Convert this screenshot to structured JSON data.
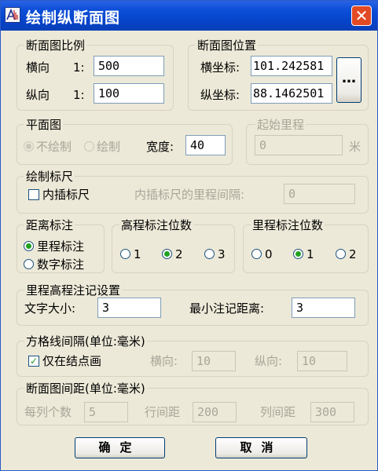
{
  "window": {
    "title": "绘制纵断面图",
    "close_glyph": "✕"
  },
  "scale": {
    "caption": "断面图比例",
    "h_label": "横向",
    "h_prefix": "1:",
    "h_value": "500",
    "v_label": "纵向",
    "v_prefix": "1:",
    "v_value": "100"
  },
  "position": {
    "caption": "断面图位置",
    "x_label": "横坐标:",
    "x_value": "101.242581",
    "y_label": "纵坐标:",
    "y_value": "88.1462501",
    "pick_label": "…"
  },
  "plan": {
    "caption": "平面图",
    "opt_none": "不绘制",
    "opt_draw": "绘制",
    "width_label": "宽度:",
    "width_value": "40"
  },
  "start": {
    "caption": "起始里程",
    "value": "0",
    "unit": "米"
  },
  "ruler": {
    "caption": "绘制标尺",
    "insert_label": "内插标尺",
    "interval_label": "内插标尺的里程间隔:",
    "interval_value": "0"
  },
  "distance": {
    "caption": "距离标注",
    "opt_mileage": "里程标注",
    "opt_number": "数字标注"
  },
  "elev_digits": {
    "caption": "高程标注位数",
    "opts": [
      "1",
      "2",
      "3"
    ]
  },
  "mile_digits": {
    "caption": "里程标注位数",
    "opts": [
      "0",
      "1",
      "2"
    ]
  },
  "annot": {
    "caption": "里程高程注记设置",
    "font_label": "文字大小:",
    "font_value": "3",
    "min_label": "最小注记距离:",
    "min_value": "3"
  },
  "grid": {
    "caption": "方格线间隔(单位:毫米)",
    "only_label": "仅在结点画",
    "check_glyph": "✓",
    "h_label": "横向:",
    "h_value": "10",
    "v_label": "纵向:",
    "v_value": "10"
  },
  "spacing": {
    "caption": "断面图间距(单位:毫米)",
    "cols_label": "每列个数",
    "cols_value": "5",
    "row_label": "行间距",
    "row_value": "200",
    "col_label": "列间距",
    "col_value": "300"
  },
  "buttons": {
    "ok": "确定",
    "cancel": "取消"
  }
}
